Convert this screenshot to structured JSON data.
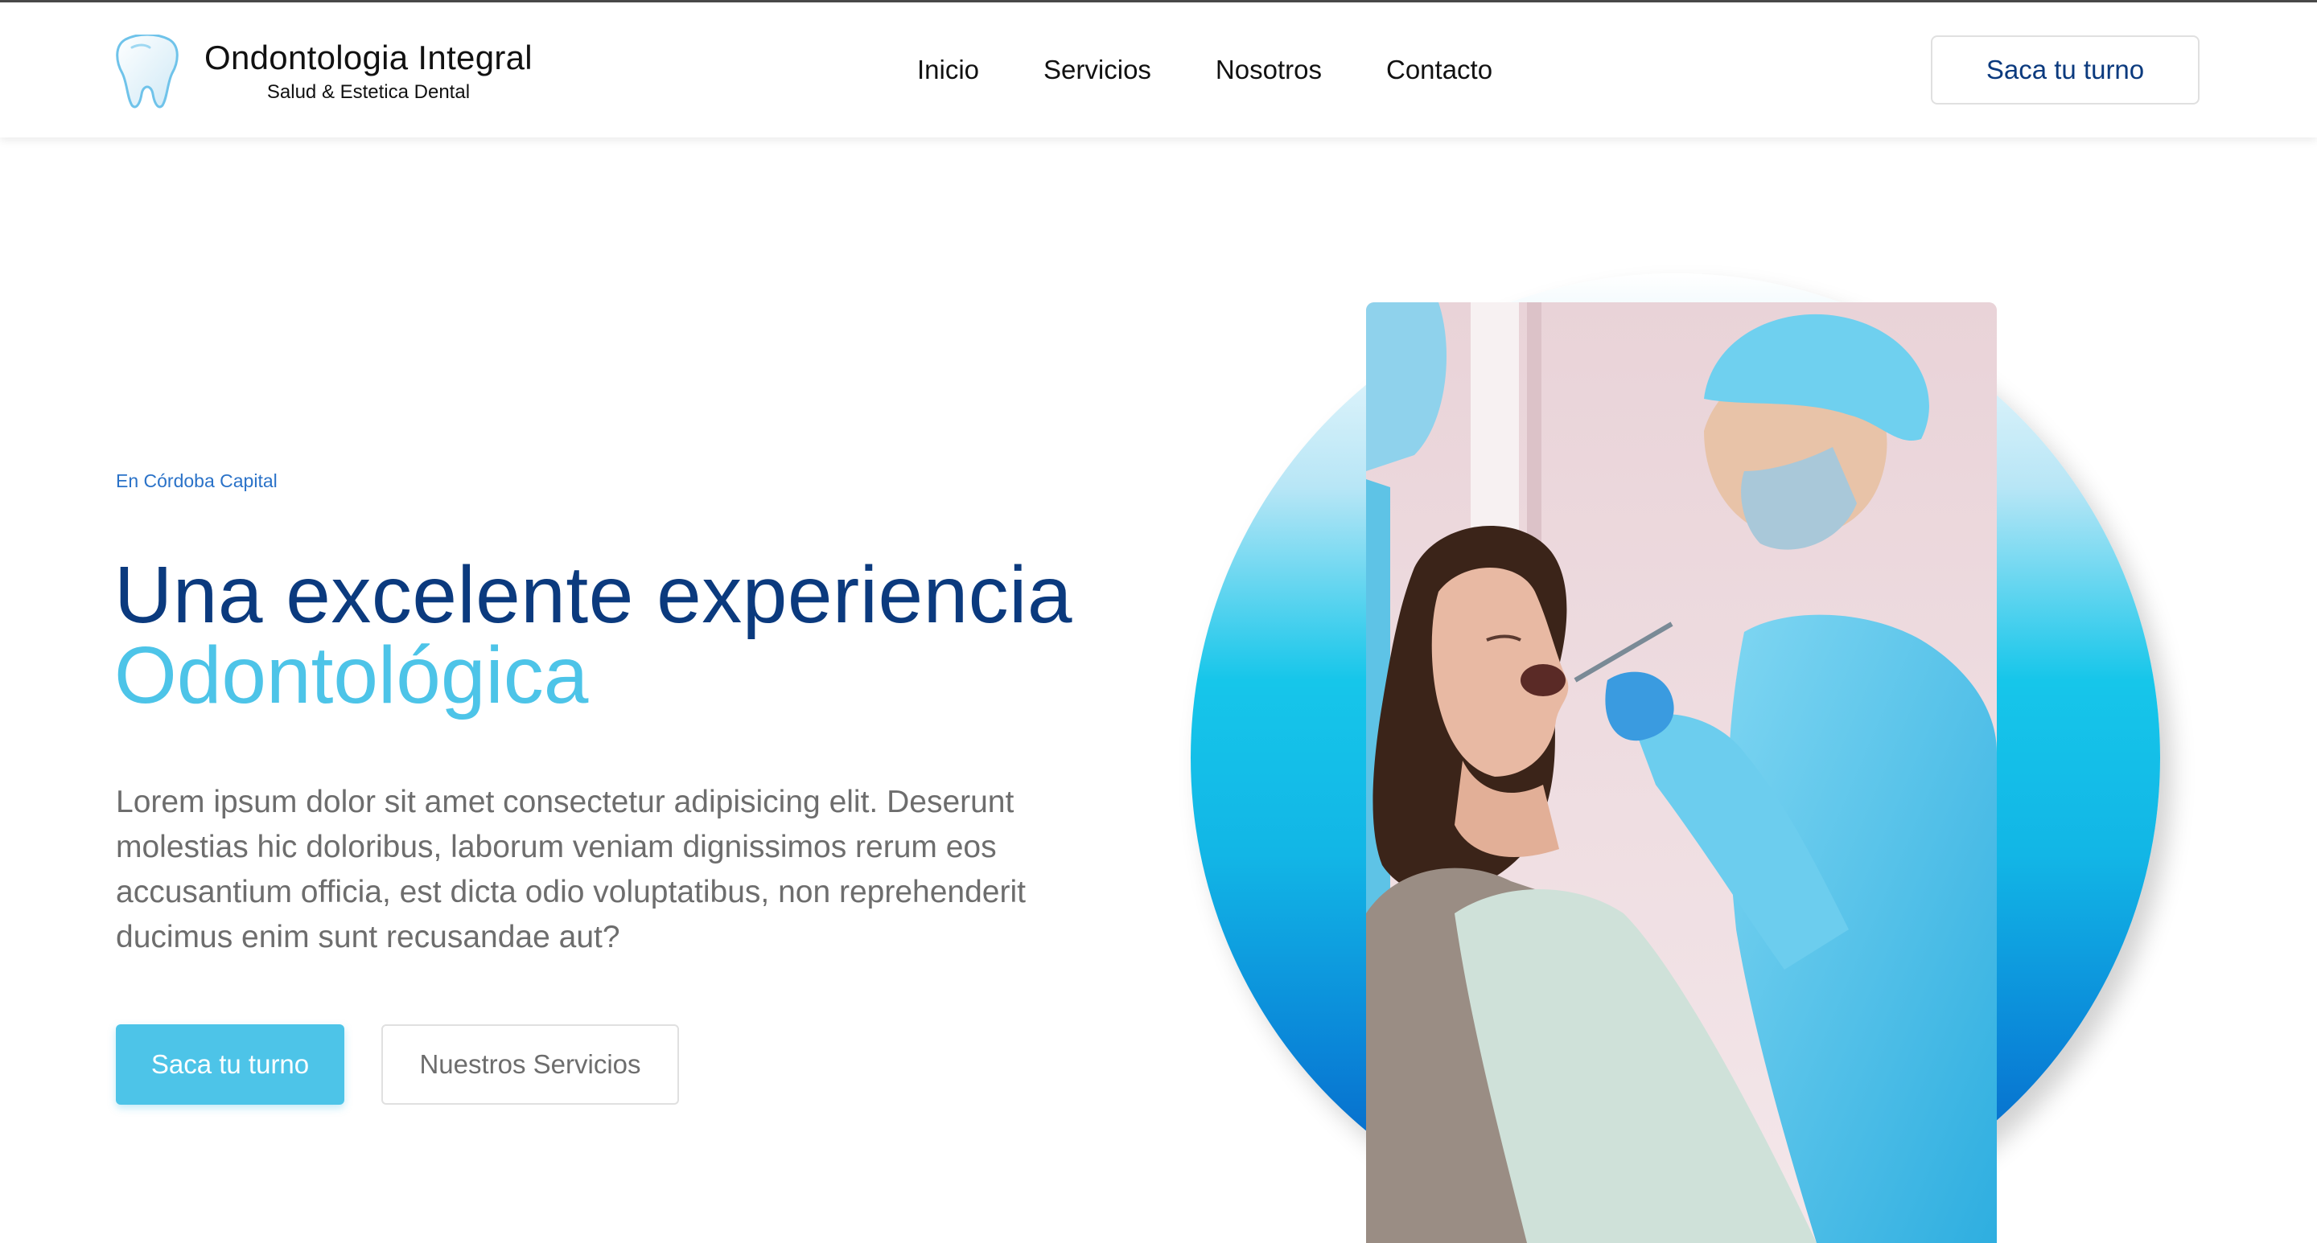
{
  "brand": {
    "title": "Ondontologia Integral",
    "subtitle": "Salud & Estetica Dental",
    "logo_icon": "tooth-icon"
  },
  "nav": {
    "items": [
      {
        "label": "Inicio"
      },
      {
        "label": "Servicios"
      },
      {
        "label": "Nosotros"
      },
      {
        "label": "Contacto"
      }
    ],
    "cta_label": "Saca tu turno"
  },
  "hero": {
    "eyebrow": "En Córdoba Capital",
    "headline_line1": "Una excelente experiencia",
    "headline_line2": "Odontológica",
    "paragraph": "Lorem ipsum dolor sit amet consectetur adipisicing elit. Deserunt molestias hic doloribus, laborum veniam dignissimos rerum eos accusantium officia, est dicta odio voluptatibus, non reprehenderit ducimus enim sunt recusandae aut?",
    "primary_button": "Saca tu turno",
    "secondary_button": "Nuestros Servicios"
  },
  "colors": {
    "primary_dark": "#0b3a7e",
    "accent": "#4dc4e8",
    "eyebrow": "#2a72c8",
    "body_text": "#6d6d6d"
  }
}
